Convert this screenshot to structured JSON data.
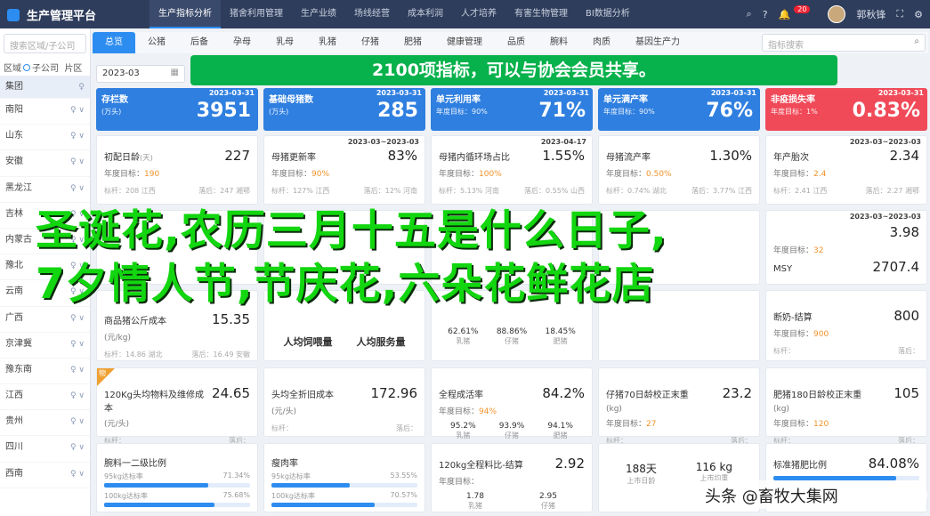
{
  "header": {
    "title": "生产管理平台",
    "nav": [
      "生产指标分析",
      "猪舍利用管理",
      "生产业绩",
      "场线经营",
      "成本利润",
      "人才培养",
      "有害生物管理",
      "BI数据分析"
    ],
    "notif": "20",
    "user": "郭秋锋"
  },
  "sidebar": {
    "search_placeholder": "搜索区域/子公司",
    "radio": [
      "区域",
      "子公司",
      "片区"
    ],
    "items": [
      "集团",
      "南阳",
      "山东",
      "安徽",
      "黑龙江",
      "吉林",
      "内蒙古",
      "豫北",
      "云南",
      "广西",
      "京津冀",
      "豫东南",
      "江西",
      "贵州",
      "四川",
      "西南"
    ]
  },
  "tabs": [
    "总览",
    "公猪",
    "后备",
    "孕母",
    "乳母",
    "乳猪",
    "仔猪",
    "肥猪",
    "健康管理",
    "品质",
    "腕料",
    "肉质",
    "基因生产力"
  ],
  "index_search": "指标搜索",
  "date": "2023-03",
  "banner": "2100项指标，可以与协会会员共享。",
  "kpis": [
    {
      "t": "存栏数",
      "s": "(万头)",
      "d": "2023-03-31",
      "v": "3951",
      "c": "#2f7fe0"
    },
    {
      "t": "基础母猪数",
      "s": "(万头)",
      "d": "2023-03-31",
      "v": "285",
      "c": "#2f7fe0"
    },
    {
      "t": "单元利用率",
      "s": "年度目标：90%",
      "d": "2023-03-31",
      "v": "71%",
      "c": "#2f7fe0"
    },
    {
      "t": "单元满产率",
      "s": "年度目标：90%",
      "d": "2023-03-31",
      "v": "76%",
      "c": "#2f7fe0"
    },
    {
      "t": "非疫损失率",
      "s": "年度目标：1%",
      "d": "2023-03-31",
      "v": "0.83%",
      "c": "#f04a59"
    }
  ],
  "row1": [
    {
      "t": "初配日龄",
      "u": "(天)",
      "v": "227",
      "g": "年度目标：",
      "gv": "190",
      "f1": "标杆：208 江西",
      "f2": "落后：247 湘鄂"
    },
    {
      "t": "母猪更新率",
      "d": "2023-03~2023-03",
      "v": "83%",
      "g": "年度目标：",
      "gv": "90%",
      "f1": "标杆：127% 江西",
      "f2": "落后：12% 河南"
    },
    {
      "t": "母猪内循环场占比",
      "d": "2023-04-17",
      "v": "1.55%",
      "g": "年度目标：",
      "gv": "100%",
      "f1": "标杆：5.13% 河南",
      "f2": "落后：0.55% 山西"
    },
    {
      "t": "母猪流产率",
      "v": "1.30%",
      "g": "年度目标：",
      "gv": "0.50%",
      "f1": "标杆：0.74% 湖北",
      "f2": "落后：3.77% 江西"
    },
    {
      "t": "年产胎次",
      "d": "2023-03~2023-03",
      "v": "2.34",
      "g": "年度目标：",
      "gv": "2.4",
      "f1": "标杆：2.41 江西",
      "f2": "落后：2.27 湘鄂"
    }
  ],
  "row2": [
    {
      "t": "",
      "v": "3.98",
      "d": "2023-03~2023-03",
      "g": "年度目标：",
      "gv": "32"
    },
    {
      "t": "MSY",
      "v": "2707.4",
      "g": "年度目标：",
      "gv": "",
      "f1": "",
      "f2": ""
    }
  ],
  "row3a": [
    {
      "t": "商品猪公斤成本",
      "u": "(元/kg)",
      "v": "15.35",
      "f1": "标杆：14.86 湖北",
      "f2": "落后：16.49 安徽"
    }
  ],
  "row3": {
    "btn1": "人均饲喂量",
    "btn2": "人均服务量",
    "m": [
      {
        "v": "62.61%",
        "l": "乳猪"
      },
      {
        "v": "88.86%",
        "l": "仔猪"
      },
      {
        "v": "18.45%",
        "l": "肥猪"
      }
    ],
    "r": {
      "t": "断奶-结算",
      "v": "800",
      "g": "年度目标：",
      "gv": "900",
      "f1": "标杆：",
      "f2": "落后："
    }
  },
  "row4": [
    {
      "t": "120Kg头均物料及维修成本",
      "u": "(元/头)",
      "v": "24.65",
      "f1": "标杆：",
      "f2": "落后："
    },
    {
      "t": "头均全折旧成本",
      "u": "(元/头)",
      "v": "172.96",
      "f1": "标杆：",
      "f2": "落后："
    },
    {
      "t": "全程成活率",
      "v": "84.2%",
      "g": "年度目标：",
      "gv": "94%",
      "m": [
        {
          "v": "95.2%",
          "l": "乳猪"
        },
        {
          "v": "93.9%",
          "l": "仔猪"
        },
        {
          "v": "94.1%",
          "l": "肥猪"
        }
      ]
    },
    {
      "t": "仔猪70日龄校正末重",
      "u": "(kg)",
      "v": "23.2",
      "g": "年度目标：",
      "gv": "27",
      "f1": "标杆：",
      "f2": "落后："
    },
    {
      "t": "肥猪180日龄校正末重",
      "u": "(kg)",
      "v": "105",
      "g": "年度目标：",
      "gv": "120",
      "f1": "标杆：",
      "f2": "落后："
    }
  ],
  "row5": [
    {
      "t": "腕料一二级比例",
      "b": [
        {
          "l": "95kg达标率",
          "v": "71.34%",
          "p": 71.34
        },
        {
          "l": "100kg达标率",
          "v": "75.68%",
          "p": 75.68
        }
      ]
    },
    {
      "t": "瘦肉率",
      "b": [
        {
          "l": "95kg达标率",
          "v": "53.55%",
          "p": 53.55
        },
        {
          "l": "100kg达标率",
          "v": "70.57%",
          "p": 70.57
        }
      ]
    },
    {
      "t": "120kg全程料比-结算",
      "v": "2.92",
      "g": "年度目标：",
      "gv": "",
      "m": [
        {
          "v": "1.78",
          "l": "乳猪"
        },
        {
          "v": "2.95",
          "l": "仔猪"
        }
      ]
    },
    {
      "t": "",
      "m": [
        {
          "v": "188天",
          "l": "上市日龄"
        },
        {
          "v": "116 kg",
          "l": "上市均重"
        }
      ]
    },
    {
      "t": "标准猪肥比例",
      "v": "84.08%",
      "b": [
        {
          "l": "",
          "v": "",
          "p": 84
        }
      ]
    }
  ],
  "overlay": [
    "圣诞花,农历三月十五是什么日子,",
    "7夕情人节,节庆花,六朵花鲜花店"
  ],
  "watermark": "头条 @畜牧大集网"
}
